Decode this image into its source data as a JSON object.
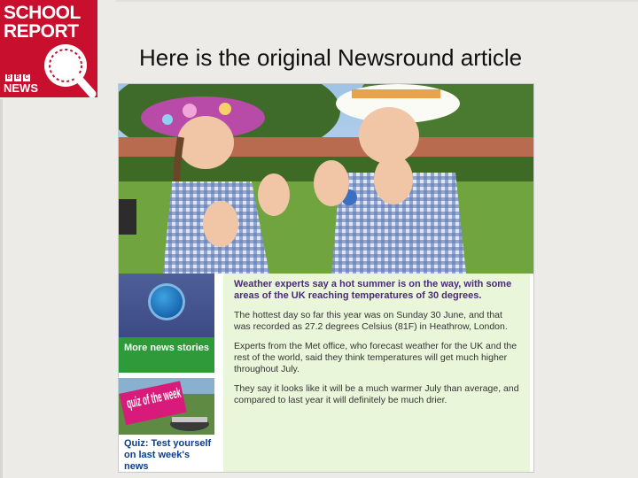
{
  "logo": {
    "line1": "SCHOOL",
    "line2": "REPORT",
    "bbc": [
      "B",
      "B",
      "C"
    ],
    "news": "NEWS"
  },
  "slide": {
    "title": "Here is the original Newsround article"
  },
  "article": {
    "sidebar": {
      "more_news": "More news stories",
      "quiz_image_text": "quiz of the week",
      "quiz_caption": "Quiz: Test yourself on last week's news"
    },
    "paragraphs": [
      "Weather experts say a hot summer is on the way, with some areas of the UK reaching temperatures of 30 degrees.",
      "The hottest day so far this year was on Sunday 30 June, and that was recorded as 27.2 degrees Celsius (81F) in Heathrow, London.",
      "Experts from the Met office, who forecast weather for the UK and the rest of the world, said they think temperatures will get much higher throughout July.",
      "They say it looks like it will be a much warmer July than average, and compared to last year it will definitely be much drier."
    ]
  },
  "colors": {
    "logo_red": "#c8102e",
    "lead_purple": "#4a2a7a",
    "panel_green": "#e9f6d9",
    "news_green": "#2e9a3a"
  }
}
